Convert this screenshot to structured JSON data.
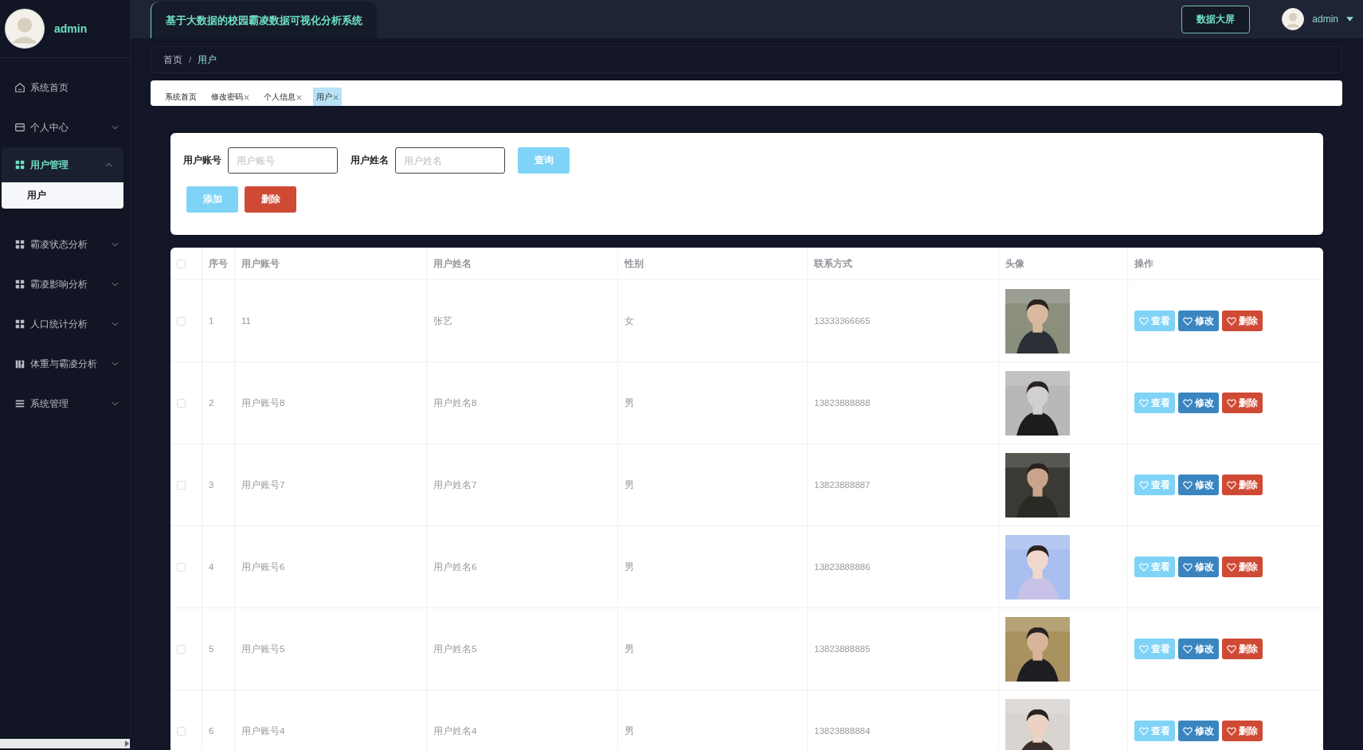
{
  "sidebar": {
    "user": "admin",
    "items": [
      {
        "label": "系统首页",
        "expandable": false,
        "expanded": false
      },
      {
        "label": "个人中心",
        "expandable": true,
        "expanded": false
      },
      {
        "label": "用户管理",
        "expandable": true,
        "expanded": true,
        "children": [
          {
            "label": "用户",
            "selected": true
          }
        ]
      },
      {
        "label": "霸凌状态分析",
        "expandable": true,
        "expanded": false
      },
      {
        "label": "霸凌影响分析",
        "expandable": true,
        "expanded": false
      },
      {
        "label": "人口统计分析",
        "expandable": true,
        "expanded": false
      },
      {
        "label": "体重与霸凌分析",
        "expandable": true,
        "expanded": false
      },
      {
        "label": "系统管理",
        "expandable": true,
        "expanded": false
      }
    ]
  },
  "header": {
    "title": "基于大数据的校园霸凌数据可视化分析系统",
    "screen_button": "数据大屏",
    "user": "admin"
  },
  "breadcrumb": {
    "items": [
      "首页",
      "用户"
    ],
    "separator": "/"
  },
  "tabs": [
    {
      "label": "系统首页",
      "closable": false,
      "selected": false
    },
    {
      "label": "修改密码",
      "closable": true,
      "selected": false
    },
    {
      "label": "个人信息",
      "closable": true,
      "selected": false
    },
    {
      "label": "用户",
      "closable": true,
      "selected": true
    }
  ],
  "search": {
    "fields": [
      {
        "label": "用户账号",
        "placeholder": "用户账号"
      },
      {
        "label": "用户姓名",
        "placeholder": "用户姓名"
      }
    ],
    "query_button": "查询",
    "add_button": "添加",
    "delete_button": "删除"
  },
  "table": {
    "select_all_checked": false,
    "columns": [
      "序号",
      "用户账号",
      "用户姓名",
      "性别",
      "联系方式",
      "头像",
      "操作"
    ],
    "rows": [
      {
        "checked": false,
        "cells": [
          "1",
          "11",
          "张艺",
          "女",
          "13333366665"
        ],
        "photo": {
          "kind": "picture"
        },
        "actions": [
          {
            "kind": "view",
            "label": "查看"
          },
          {
            "kind": "edit",
            "label": "修改"
          },
          {
            "kind": "delete",
            "label": "删除"
          }
        ]
      },
      {
        "checked": false,
        "cells": [
          "2",
          "用户账号8",
          "用户姓名8",
          "男",
          "13823888888"
        ],
        "photo": {
          "kind": "picture"
        },
        "actions": [
          {
            "kind": "view",
            "label": "查看"
          },
          {
            "kind": "edit",
            "label": "修改"
          },
          {
            "kind": "delete",
            "label": "删除"
          }
        ]
      },
      {
        "checked": false,
        "cells": [
          "3",
          "用户账号7",
          "用户姓名7",
          "男",
          "13823888887"
        ],
        "photo": {
          "kind": "picture"
        },
        "actions": [
          {
            "kind": "view",
            "label": "查看"
          },
          {
            "kind": "edit",
            "label": "修改"
          },
          {
            "kind": "delete",
            "label": "删除"
          }
        ]
      },
      {
        "checked": false,
        "cells": [
          "4",
          "用户账号6",
          "用户姓名6",
          "男",
          "13823888886"
        ],
        "photo": {
          "kind": "picture"
        },
        "actions": [
          {
            "kind": "view",
            "label": "查看"
          },
          {
            "kind": "edit",
            "label": "修改"
          },
          {
            "kind": "delete",
            "label": "删除"
          }
        ]
      },
      {
        "checked": false,
        "cells": [
          "5",
          "用户账号5",
          "用户姓名5",
          "男",
          "13823888885"
        ],
        "photo": {
          "kind": "picture"
        },
        "actions": [
          {
            "kind": "view",
            "label": "查看"
          },
          {
            "kind": "edit",
            "label": "修改"
          },
          {
            "kind": "delete",
            "label": "删除"
          }
        ]
      },
      {
        "checked": false,
        "cells": [
          "6",
          "用户账号4",
          "用户姓名4",
          "男",
          "13823888884"
        ],
        "photo": {
          "kind": "picture"
        },
        "actions": [
          {
            "kind": "view",
            "label": "查看"
          },
          {
            "kind": "edit",
            "label": "修改"
          },
          {
            "kind": "delete",
            "label": "删除"
          }
        ]
      }
    ]
  }
}
